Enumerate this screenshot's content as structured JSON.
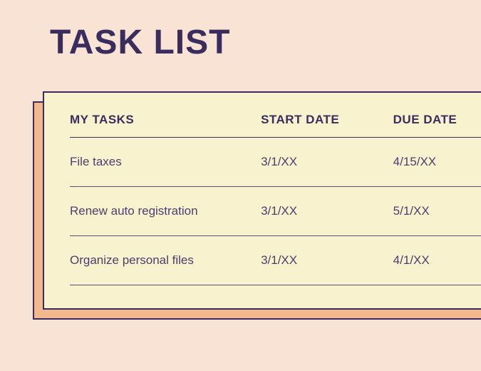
{
  "title": "TASK LIST",
  "columns": {
    "tasks": "MY TASKS",
    "start": "START DATE",
    "due": "DUE DATE"
  },
  "rows": [
    {
      "task": "File taxes",
      "start": "3/1/XX",
      "due": "4/15/XX"
    },
    {
      "task": "Renew auto registration",
      "start": "3/1/XX",
      "due": "5/1/XX"
    },
    {
      "task": "Organize personal files",
      "start": "3/1/XX",
      "due": "4/1/XX"
    }
  ]
}
